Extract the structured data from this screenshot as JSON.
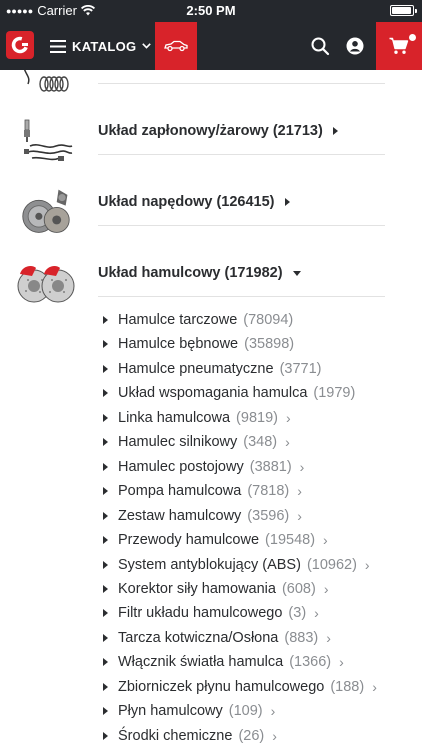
{
  "status_bar": {
    "carrier": "Carrier",
    "time": "2:50 PM",
    "battery_level": 0.95
  },
  "navbar": {
    "menu_label": "KATALOG",
    "icons": [
      "logo-icon",
      "hamburger-icon",
      "chevron-down-icon",
      "car-icon",
      "search-icon",
      "account-icon",
      "cart-icon"
    ],
    "accent": "#d8232a",
    "background": "#25282d"
  },
  "categories": [
    {
      "label": "Układ zapłonowy/żarowy (21713)",
      "expanded": false,
      "icon": "spark-plug-cables-icon"
    },
    {
      "label": "Układ napędowy (126415)",
      "expanded": false,
      "icon": "clutch-kit-icon"
    },
    {
      "label": "Układ hamulcowy (171982)",
      "expanded": true,
      "icon": "brake-caliper-icon"
    }
  ],
  "subcategories": [
    {
      "name": "Hamulce tarczowe",
      "count": "(78094)",
      "chevron": false
    },
    {
      "name": "Hamulce bębnowe",
      "count": "(35898)",
      "chevron": false
    },
    {
      "name": "Hamulce pneumatyczne",
      "count": "(3771)",
      "chevron": false
    },
    {
      "name": "Układ wspomagania hamulca",
      "count": "(1979)",
      "chevron": false
    },
    {
      "name": "Linka hamulcowa",
      "count": "(9819)",
      "chevron": true
    },
    {
      "name": "Hamulec silnikowy",
      "count": "(348)",
      "chevron": true
    },
    {
      "name": "Hamulec postojowy",
      "count": "(3881)",
      "chevron": true
    },
    {
      "name": "Pompa hamulcowa",
      "count": "(7818)",
      "chevron": true
    },
    {
      "name": "Zestaw hamulcowy",
      "count": "(3596)",
      "chevron": true
    },
    {
      "name": "Przewody hamulcowe",
      "count": "(19548)",
      "chevron": true
    },
    {
      "name": "System antyblokujący (ABS)",
      "count": "(10962)",
      "chevron": true
    },
    {
      "name": "Korektor siły hamowania",
      "count": "(608)",
      "chevron": true
    },
    {
      "name": "Filtr układu hamulcowego",
      "count": "(3)",
      "chevron": true
    },
    {
      "name": "Tarcza kotwiczna/Osłona",
      "count": "(883)",
      "chevron": true
    },
    {
      "name": "Włącznik światła hamulca",
      "count": "(1366)",
      "chevron": true
    },
    {
      "name": "Zbiorniczek płynu hamulcowego",
      "count": "(188)",
      "chevron": true
    },
    {
      "name": "Płyn hamulcowy",
      "count": "(109)",
      "chevron": true
    },
    {
      "name": "Środki chemiczne",
      "count": "(26)",
      "chevron": true
    }
  ],
  "chevron_glyph": "›"
}
